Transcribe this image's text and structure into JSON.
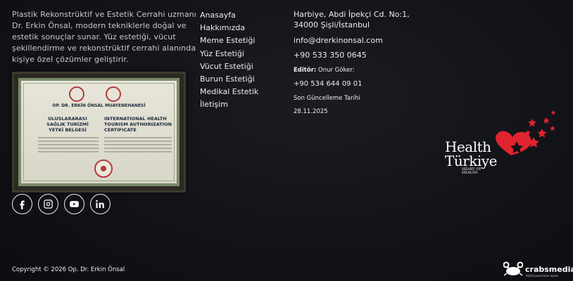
{
  "about": {
    "text": "Plastik Rekonstrüktif ve Estetik Cerrahi uzmanı Dr. Erkin Önsal, modern tekniklerle doğal ve estetik sonuçlar sunar. Yüz estetiği, vücut şekillendirme ve rekonstrüktif cerrahi alanında kişiye özel çözümler geliştirir."
  },
  "certificate": {
    "title": "OP. DR. ERKİN ÖNSAL MUAYENEHANESİ",
    "left_heading": "ULUSLARARASI SAĞLIK TURİZMİ YETKİ BELGESİ",
    "right_heading": "INTERNATIONAL HEALTH TOURISM AUTHORIZATION CERTIFICATE"
  },
  "social": [
    {
      "name": "facebook-icon"
    },
    {
      "name": "instagram-icon"
    },
    {
      "name": "youtube-icon"
    },
    {
      "name": "linkedin-icon"
    }
  ],
  "nav": {
    "items": [
      "Anasayfa",
      "Hakkımızda",
      "Meme Estetiği",
      "Yüz Estetiği",
      "Vücut Estetiği",
      "Burun Estetiği",
      "Medikal Estetik",
      "İletişim"
    ]
  },
  "contact": {
    "address": "Harbiye, Abdi İpekçi Cd. No:1, 34000 Şişli/İstanbul",
    "email": "info@drerkinonsal.com",
    "phone": "+90 533 350 0645",
    "editor_label": "Editör:",
    "editor_name": "Onur Göker:",
    "phone2": "+90 534 644 09 01",
    "updated_label": "Son Güncelleme Tarihi",
    "updated_date": "28.11.2025"
  },
  "health_turkiye": {
    "line1": "Health",
    "line2": "Türkiye",
    "tagline1": "HEART OF",
    "tagline2": "HEALTH"
  },
  "footer": {
    "copyright": "Copyright © 2026 Op. Dr. Erkin Önsal",
    "agency": "crabsmedia",
    "agency_sub": "dijital pazarlama ajansı"
  },
  "colors": {
    "background": "#121318",
    "text": "#ececf0",
    "brand_red": "#e0242f"
  }
}
